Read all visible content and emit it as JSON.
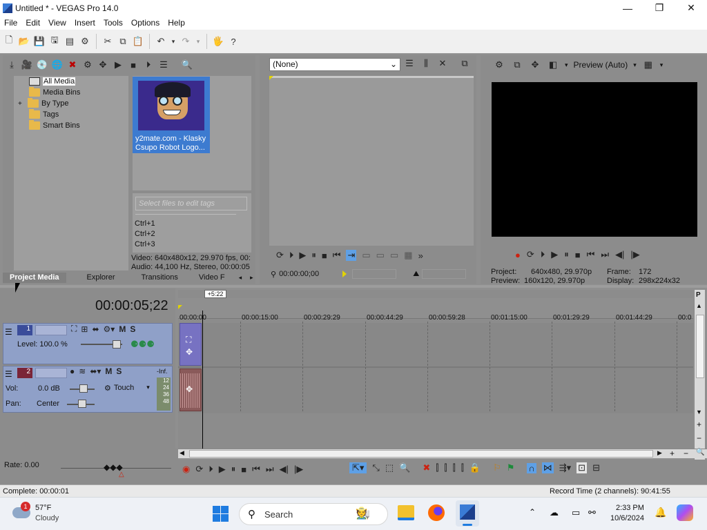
{
  "window": {
    "title": "Untitled * - VEGAS Pro 14.0",
    "minimize": "—",
    "maximize": "❐",
    "close": "✕"
  },
  "menu": [
    "File",
    "Edit",
    "View",
    "Insert",
    "Tools",
    "Options",
    "Help"
  ],
  "project_media": {
    "tree": [
      {
        "label": "All Media",
        "expander": ""
      },
      {
        "label": "Media Bins",
        "expander": ""
      },
      {
        "label": "By Type",
        "expander": "+"
      },
      {
        "label": "Tags",
        "expander": ""
      },
      {
        "label": "Smart Bins",
        "expander": ""
      }
    ],
    "thumb_caption_1": "y2mate.com - Klasky",
    "thumb_caption_2": "Csupo Robot Logo...",
    "tags_placeholder": "Select files to edit tags",
    "shortcuts": [
      "Ctrl+1",
      "Ctrl+2",
      "Ctrl+3"
    ],
    "info_video": "Video: 640x480x12, 29.970 fps, 00:",
    "info_audio": "Audio: 44,100 Hz, Stereo, 00:00:05"
  },
  "tabs": [
    "Project Media",
    "Explorer",
    "Transitions",
    "Video F"
  ],
  "trimmer": {
    "dropdown": "(None)",
    "timecode": "00:00:00;00"
  },
  "preview": {
    "mode": "Preview (Auto)",
    "project_label": "Project:",
    "project_value": "640x480, 29.970p",
    "preview_label": "Preview:",
    "preview_value": "160x120, 29.970p",
    "frame_label": "Frame:",
    "frame_value": "172",
    "display_label": "Display:",
    "display_value": "298x224x32"
  },
  "timeline": {
    "timecode": "00:00:05;22",
    "marker_label": "+5:22",
    "ruler": [
      "00:00:00",
      "00:00:15:00",
      "00:00:29:29",
      "00:00:44:29",
      "00:00:59:28",
      "00:01:15:00",
      "00:01:29:29",
      "00:01:44:29",
      "00:0"
    ]
  },
  "tracks": {
    "video": {
      "number": "1",
      "m": "M",
      "s": "S",
      "level_label": "Level: 100.0 %"
    },
    "audio": {
      "number": "2",
      "m": "M",
      "s": "S",
      "vol_label": "Vol:",
      "vol_value": "0.0 dB",
      "pan_label": "Pan:",
      "pan_value": "Center",
      "touch": "Touch",
      "meter": [
        "-Inf.",
        "12",
        "24",
        "36",
        "48"
      ]
    }
  },
  "rate": "Rate: 0.00",
  "status": {
    "left": "Complete: 00:00:01",
    "right": "Record Time (2 channels): 90:41:55"
  },
  "taskbar": {
    "weather_temp": "57°F",
    "weather_desc": "Cloudy",
    "weather_badge": "1",
    "search": "Search",
    "time": "2:33 PM",
    "date": "10/6/2024"
  }
}
